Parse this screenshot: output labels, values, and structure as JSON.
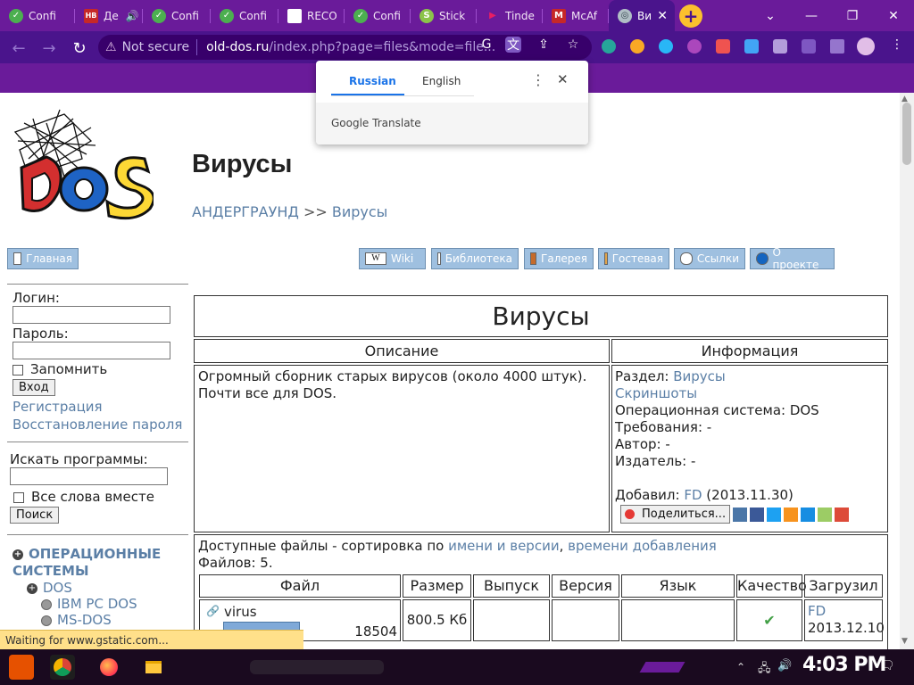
{
  "browser": {
    "tabs": [
      {
        "label": "Confi",
        "fav_color": "#4caf50",
        "fav_glyph": "✓"
      },
      {
        "label": "Де",
        "fav_color": "#c62828",
        "fav_glyph": "HB"
      },
      {
        "label": "Confi",
        "fav_color": "#4caf50",
        "fav_glyph": "✓"
      },
      {
        "label": "Confi",
        "fav_color": "#4caf50",
        "fav_glyph": "✓"
      },
      {
        "label": "RECO",
        "fav_color": "#ffffff",
        "fav_glyph": ""
      },
      {
        "label": "Confi",
        "fav_color": "#4caf50",
        "fav_glyph": "✓"
      },
      {
        "label": "Stick",
        "fav_color": "#8bc34a",
        "fav_glyph": "S"
      },
      {
        "label": "Tinde",
        "fav_color": "#e91e63",
        "fav_glyph": "▶"
      },
      {
        "label": "McAf",
        "fav_color": "#c62828",
        "fav_glyph": "M"
      },
      {
        "label": "Ви",
        "fav_color": "#b0bec5",
        "fav_glyph": "◎"
      }
    ],
    "tab_close_glyph": "✕",
    "new_tab_glyph": "+",
    "url": {
      "not_secure": "Not secure",
      "host": "old-dos.ru",
      "path": "/index.php?page=files&mode=file..."
    }
  },
  "translate": {
    "tab_source": "Russian",
    "tab_target": "English",
    "brand_google": "Google",
    "brand_translate": " Translate"
  },
  "site": {
    "page_title": "Вирусы",
    "breadcrumb_root": "АНДЕРГРАУНД",
    "breadcrumb_sep": " >> ",
    "breadcrumb_current": "Вирусы",
    "nav": {
      "home": "Главная",
      "wiki": "Wiki",
      "library": "Библиотека",
      "gallery": "Галерея",
      "guestbook": "Гостевая",
      "links": "Ссылки",
      "about": "О проекте"
    }
  },
  "sidebar": {
    "login_label": "Логин:",
    "password_label": "Пароль:",
    "remember_label": "Запомнить",
    "login_button": "Вход",
    "register_link": "Регистрация",
    "restore_link": "Восстановление пароля",
    "search_label": "Искать программы:",
    "all_words_label": "Все слова вместе",
    "search_button": "Поиск",
    "tree": {
      "os": "ОПЕРАЦИОННЫЕ СИСТЕМЫ",
      "dos": "DOS",
      "ibm": "IBM PC DOS",
      "msdos": "MS-DOS"
    }
  },
  "content": {
    "heading": "Вирусы",
    "col_description": "Описание",
    "col_info": "Информация",
    "description_line1": "Огромный сборник старых вирусов (около 4000 штук).",
    "description_line2": "Почти все для DOS.",
    "info": {
      "section_label": "Раздел: ",
      "section_value": "Вирусы",
      "screenshots": "Скриншоты",
      "os": "Операционная система: DOS",
      "requirements": "Требования: -",
      "author": "Автор: -",
      "publisher": "Издатель: -",
      "added_label": "Добавил: ",
      "added_user": "FD",
      "added_date": " (2013.11.30)",
      "share_button": "Поделиться..."
    },
    "files": {
      "available_prefix": "Доступные файлы - сортировка по ",
      "sort_name": "имени и версии",
      "sort_comma": ", ",
      "sort_time": "времени добавления",
      "count": "Файлов: 5.",
      "headers": [
        "Файл",
        "Размер",
        "Выпуск",
        "Версия",
        "Язык",
        "Качество",
        "Загрузил"
      ],
      "row1": {
        "name": "virus",
        "downloads": "18504",
        "size": "800.5 Кб",
        "quality_glyph": "✔",
        "uploader": "FD",
        "date": "2013.12.10"
      }
    }
  },
  "status": {
    "text": "Waiting for www.gstatic.com..."
  },
  "taskbar": {
    "clock": "4:03 PM"
  }
}
